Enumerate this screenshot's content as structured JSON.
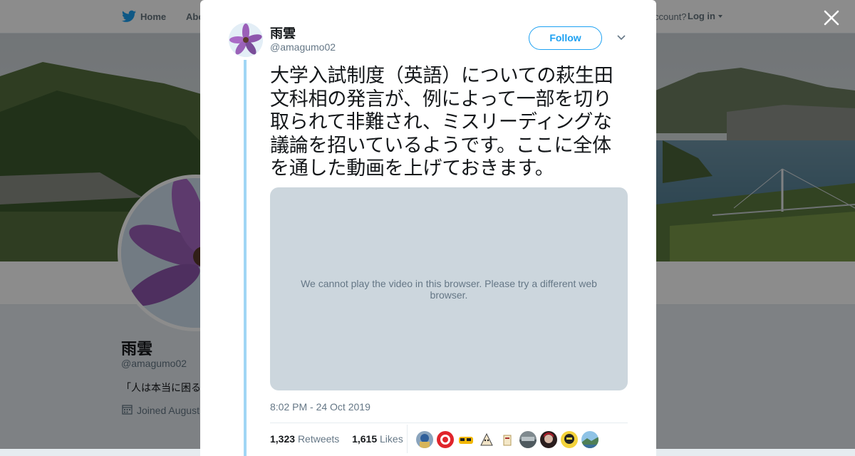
{
  "nav": {
    "home_label": "Home",
    "about_label": "Abo",
    "account_prompt": "ccount?",
    "login_label": "Log in"
  },
  "profile": {
    "name": "雨雲",
    "handle": "@amagumo02",
    "bio": "「人は本当に困る",
    "joined": "Joined August"
  },
  "tweet": {
    "author_name": "雨雲",
    "author_handle": "@amagumo02",
    "follow_label": "Follow",
    "text": "大学入試制度（英語）についての萩生田文科相の発言が、例によって一部を切り取られて非難され、ミスリーディングな議論を招いているようです。ここに全体を通した動画を上げておきます。",
    "video_message": "We cannot play the video in this browser. Please try a different web browser.",
    "timestamp": "8:02 PM - 24 Oct 2019",
    "retweets_count": "1,323",
    "retweets_label": "Retweets",
    "likes_count": "1,615",
    "likes_label": "Likes"
  },
  "colors": {
    "brand_blue": "#1da1f2",
    "thread_line": "#a0d6f5",
    "video_bg": "#ccd6dd",
    "muted_text": "#657786"
  },
  "icons": [
    "twitter-bird-icon",
    "caret-down-icon",
    "close-icon",
    "calendar-icon",
    "chevron-down-icon"
  ]
}
